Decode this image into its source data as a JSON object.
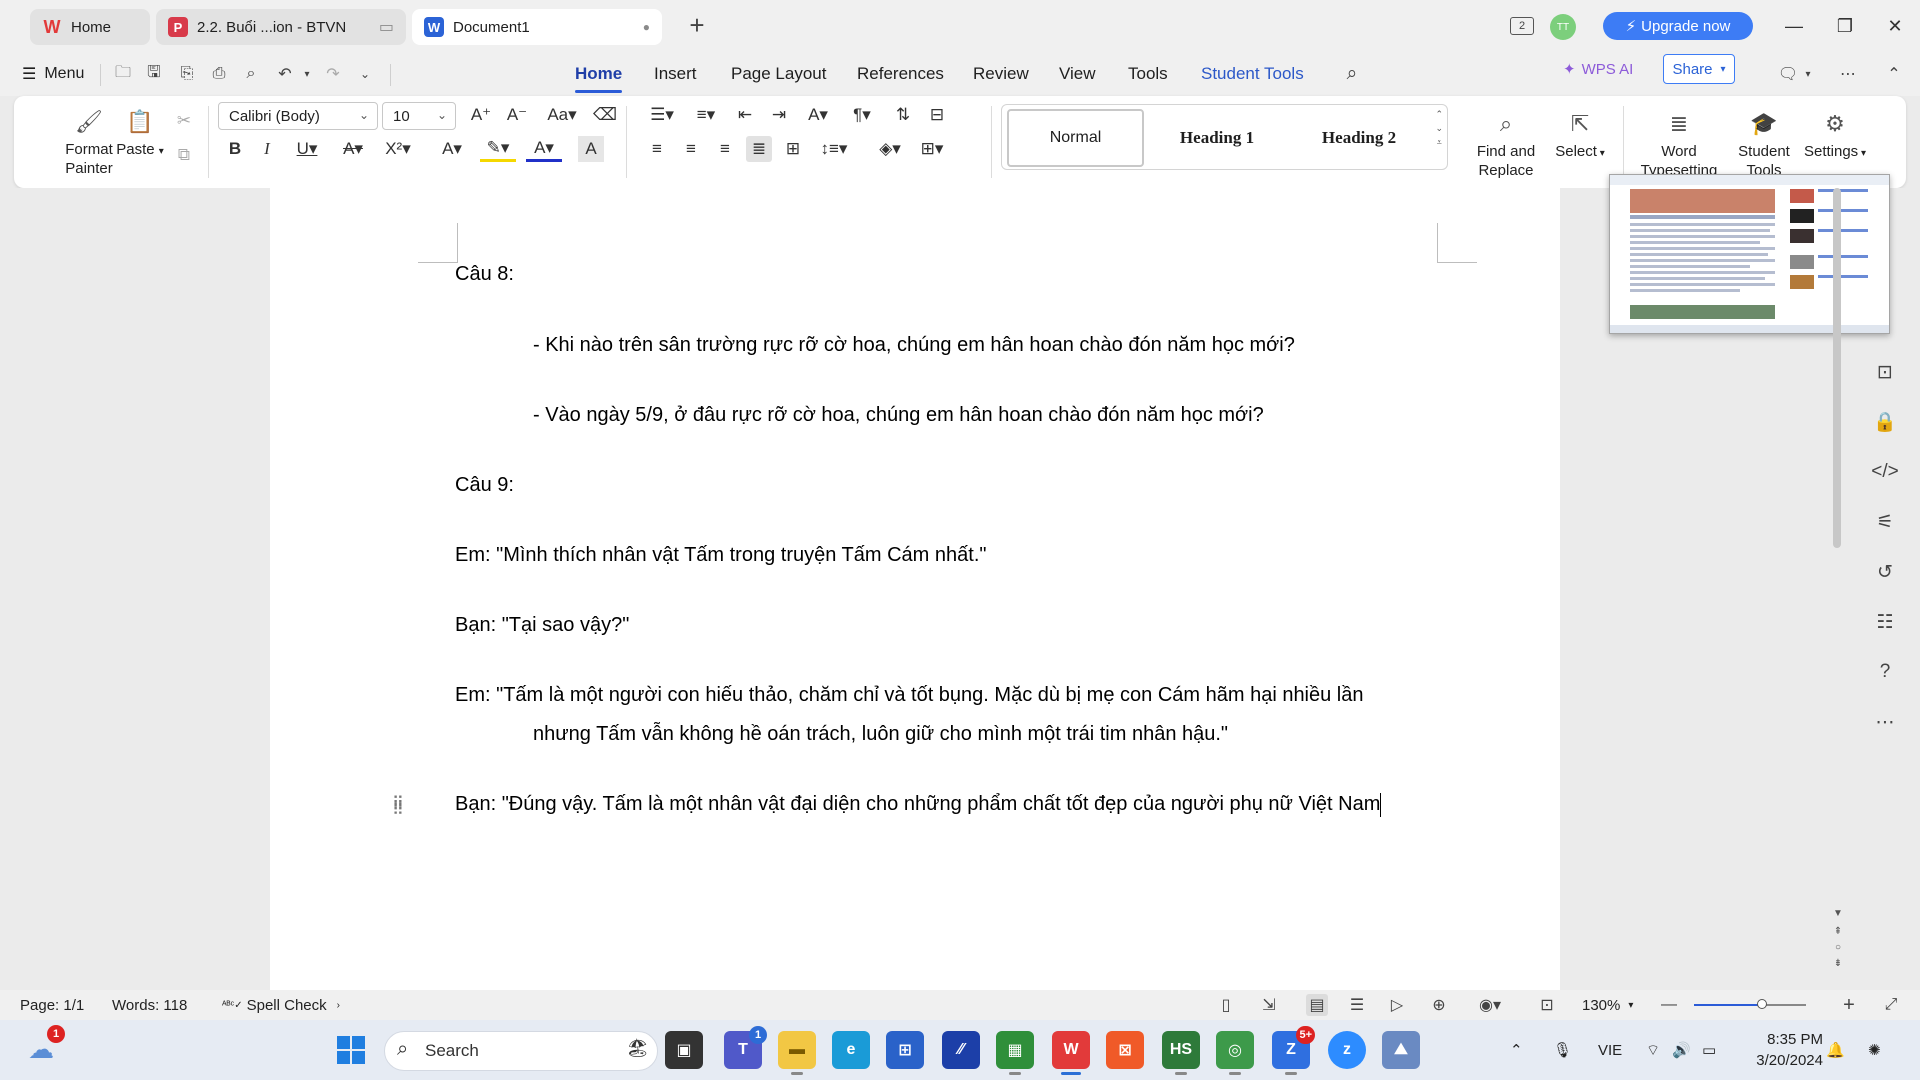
{
  "tabs": [
    {
      "label": "Home",
      "icon": "wps-logo-icon",
      "color": "#e23a3a"
    },
    {
      "label": "2.2. Buổi ...ion - BTVN",
      "icon": "pdf-icon",
      "color": "#d83a4a"
    },
    {
      "label": "Document1",
      "icon": "word-doc-icon",
      "color": "#2b63d6"
    }
  ],
  "titlebar": {
    "upgrade_label": "Upgrade now",
    "avatar_initials": "TT",
    "multi_window_count": "2"
  },
  "menubar": {
    "menu_label": "Menu",
    "items": [
      "Home",
      "Insert",
      "Page Layout",
      "References",
      "Review",
      "View",
      "Tools",
      "Student Tools"
    ],
    "active": "Home",
    "wps_ai_label": "WPS AI",
    "share_label": "Share"
  },
  "ribbon": {
    "format_painter": "Format Painter",
    "paste": "Paste",
    "font_name": "Calibri (Body)",
    "font_size": "10",
    "styles": [
      "Normal",
      "Heading 1",
      "Heading 2"
    ],
    "find_replace": "Find and Replace",
    "select": "Select",
    "word_typesetting": "Word Typesetting",
    "student_tools": "Student Tools",
    "settings": "Settings"
  },
  "document": {
    "paragraphs": [
      "Câu 8:",
      "- Khi nào trên sân trường rực rỡ cờ hoa, chúng em hân hoan chào đón năm học mới?",
      "- Vào ngày 5/9, ở đâu rực rỡ cờ hoa, chúng em hân hoan chào đón năm học mới?",
      "Câu 9:",
      "Em: \"Mình thích nhân vật Tấm trong truyện Tấm Cám nhất.\"",
      "Bạn: \"Tại sao vậy?\"",
      "Em: \"Tấm là một người con hiếu thảo, chăm chỉ và tốt bụng. Mặc dù bị mẹ con Cám hãm hại nhiều lần",
      "nhưng Tấm vẫn không hề oán trách, luôn giữ cho mình một trái tim nhân hậu.\"",
      "Bạn: \"Đúng vậy. Tấm là một nhân vật đại diện cho những phẩm chất tốt đẹp của người phụ nữ Việt Nam"
    ]
  },
  "statusbar": {
    "page": "Page: 1/1",
    "words": "Words: 118",
    "spell_check": "Spell Check",
    "zoom": "130%"
  },
  "taskbar": {
    "search_placeholder": "Search",
    "weather_badge": "1",
    "teams_badge": "1",
    "zalo_badge": "5+",
    "language": "VIE",
    "time": "8:35 PM",
    "date": "3/20/2024"
  },
  "colors": {
    "accent": "#2b5bd7",
    "upgrade": "#3d7cf5",
    "student_tools": "#2c58c8",
    "wps_ai": "#8d5bd9"
  }
}
